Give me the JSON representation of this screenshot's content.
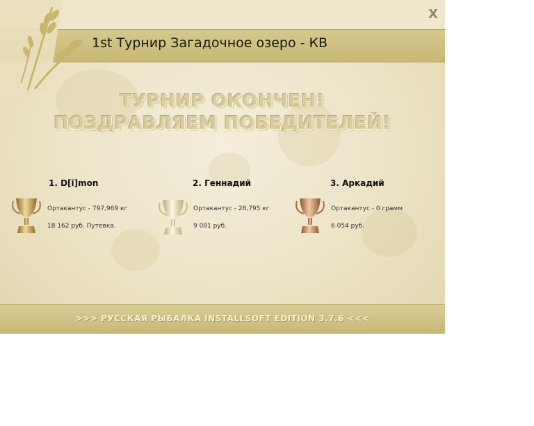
{
  "window": {
    "title": "1st Турнир Загадочное озеро - КВ",
    "close_label": "X"
  },
  "banner": {
    "line1": "ТУРНИР ОКОНЧЕН!",
    "line2": "ПОЗДРАВЛЯЕМ ПОБЕДИТЕЛЕЙ!"
  },
  "winners": [
    {
      "place": "1. D[i]mon",
      "catch": "Ортакантус - 797,969 кг",
      "prize": "18 162 руб. Путевка.",
      "trophy": "gold-trophy-icon"
    },
    {
      "place": "2. Геннадий",
      "catch": "Ортакантус - 28,795 кг",
      "prize": "9 081 руб.",
      "trophy": "silver-trophy-icon"
    },
    {
      "place": "3. Аркадий",
      "catch": "Ортакантус - 0 грамм",
      "prize": "6 054 руб.",
      "trophy": "bronze-trophy-icon"
    }
  ],
  "footer": {
    "text": ">>> РУССКАЯ РЫБАЛКА INSTALLSOFT EDITION 3.7.6 <<<"
  },
  "colors": {
    "gold": "#c9a257",
    "silver": "#e4dcb0",
    "bronze": "#c98a5b",
    "accent": "#c8b874"
  }
}
